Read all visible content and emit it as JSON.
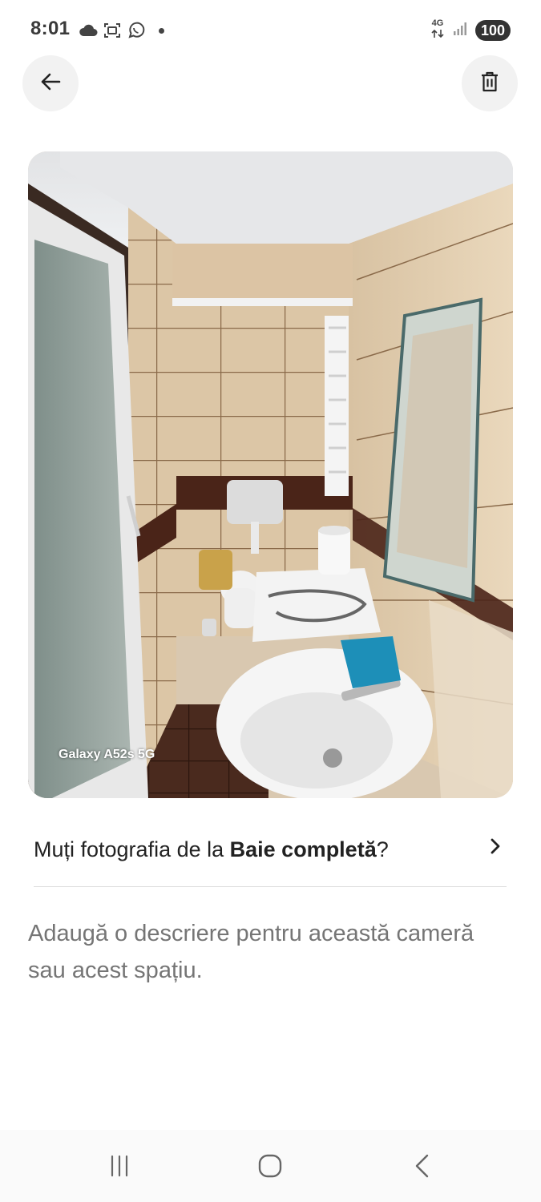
{
  "status_bar": {
    "time": "8:01",
    "network": "4G",
    "battery": "100",
    "icons": [
      "cloud-icon",
      "screenshot-icon",
      "whatsapp-icon",
      "notification-dot",
      "data-arrows-icon",
      "signal-icon"
    ]
  },
  "header": {
    "back_icon": "arrow-left-icon",
    "delete_icon": "trash-icon"
  },
  "photo": {
    "watermark": "Galaxy A52s 5G"
  },
  "move_prompt": {
    "prefix": "Muți fotografia de la ",
    "room": "Baie completă",
    "suffix": "?",
    "chevron_icon": "chevron-right-icon"
  },
  "description": {
    "placeholder": "Adaugă o descriere pentru această cameră sau acest spațiu.",
    "value": ""
  },
  "navigation_bar": {
    "icons": [
      "recent-apps-icon",
      "home-icon",
      "nav-back-icon"
    ]
  },
  "colors": {
    "background": "#ffffff",
    "button_bg": "#f2f2f2",
    "text_primary": "#222222",
    "text_secondary": "#717171",
    "divider": "#dddddd"
  }
}
